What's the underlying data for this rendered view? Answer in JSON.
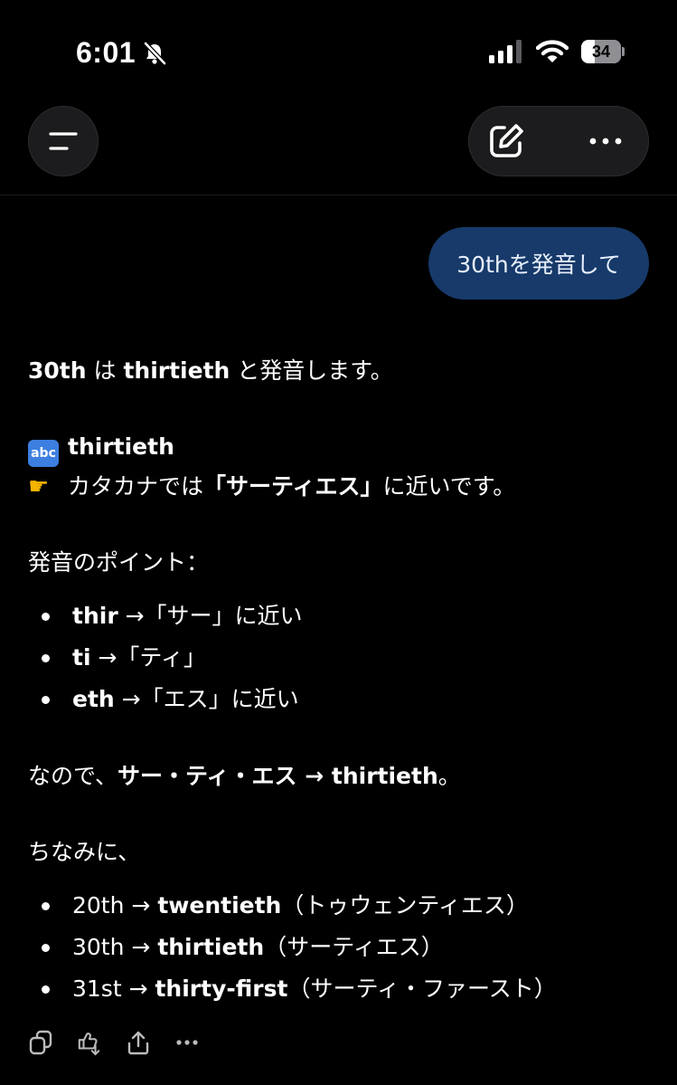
{
  "status_bar": {
    "time": "6:01",
    "battery_level": "34",
    "battery_fraction": 0.34
  },
  "user_message": "30thを発音して",
  "assistant": {
    "line1": {
      "p1": "30th",
      "p2": " は ",
      "p3": "thirtieth",
      "p4": " と発音します。"
    },
    "word_line": "thirtieth",
    "abc_label": "abc",
    "katakana_line": {
      "p1": "カタカナでは",
      "p2": "「サーティエス」",
      "p3": "に近いです。"
    },
    "points_title": "発音のポイント：",
    "points": [
      {
        "key": "thir",
        "rest": " →「サー」に近い"
      },
      {
        "key": "ti",
        "rest": " →「ティ」"
      },
      {
        "key": "eth",
        "rest": " →「エス」に近い"
      }
    ],
    "summary": {
      "p1": "なので、",
      "p2": "サー・ティ・エス → thirtieth",
      "p3": "。"
    },
    "examples_title": "ちなみに、",
    "examples": [
      {
        "pre": "20th → ",
        "word": "twentieth",
        "post": "（トゥウェンティエス）"
      },
      {
        "pre": "30th → ",
        "word": "thirtieth",
        "post": "（サーティエス）"
      },
      {
        "pre": "31st → ",
        "word": "thirty-first",
        "post": "（サーティ・ファースト）"
      }
    ]
  },
  "icons": {
    "bell": "bell-slash-icon",
    "cellular": "cellular-signal-icon",
    "wifi": "wifi-icon",
    "battery": "battery-icon",
    "menu": "menu-icon",
    "edit": "edit-icon",
    "more": "more-icon",
    "copy": "copy-icon",
    "feedback": "thumbs-feedback-icon",
    "share": "share-icon",
    "more_actions": "more-horizontal-icon"
  },
  "colors": {
    "background": "#000000",
    "user_bubble": "#173a6a",
    "text": "#ffffff"
  }
}
